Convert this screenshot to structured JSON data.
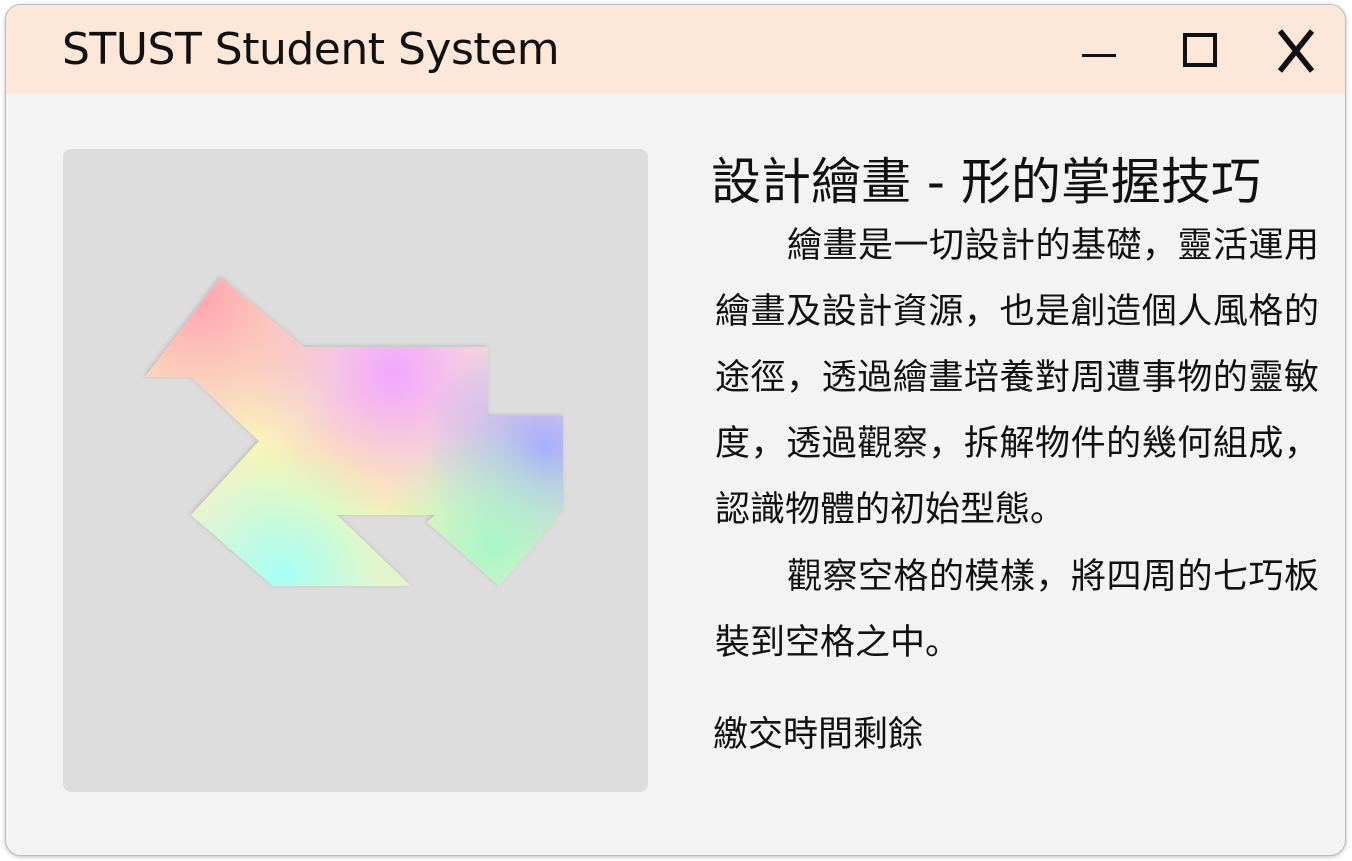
{
  "window": {
    "title": "STUST Student System",
    "controls": {
      "minimize_icon": "minimize-icon",
      "maximize_icon": "maximize-icon",
      "close_icon": "close-icon"
    },
    "colors": {
      "titlebar_bg": "#fde7d8",
      "body_bg": "#f3f3f3",
      "panel_bg": "#dddddd"
    }
  },
  "lesson": {
    "heading": "設計繪畫 - 形的掌握技巧",
    "paragraph1": "繪畫是一切設計的基礎，靈活運用繪畫及設計資源，也是創造個人風格的途徑，透過繪畫培養對周遭事物的靈敏度，透過觀察，拆解物件的幾何組成，認識物體的初始型態。",
    "paragraph2": "觀察空格的模樣，將四周的七巧板裝到空格之中。",
    "submit_timer_label": "繳交時間剩餘"
  },
  "puzzle": {
    "name": "tangram-target-silhouette",
    "gradient_colors": [
      "#ffa8a8",
      "#f0a8ff",
      "#fff5a0",
      "#a8a8ff",
      "#a8f8c8",
      "#a8fff8"
    ]
  }
}
